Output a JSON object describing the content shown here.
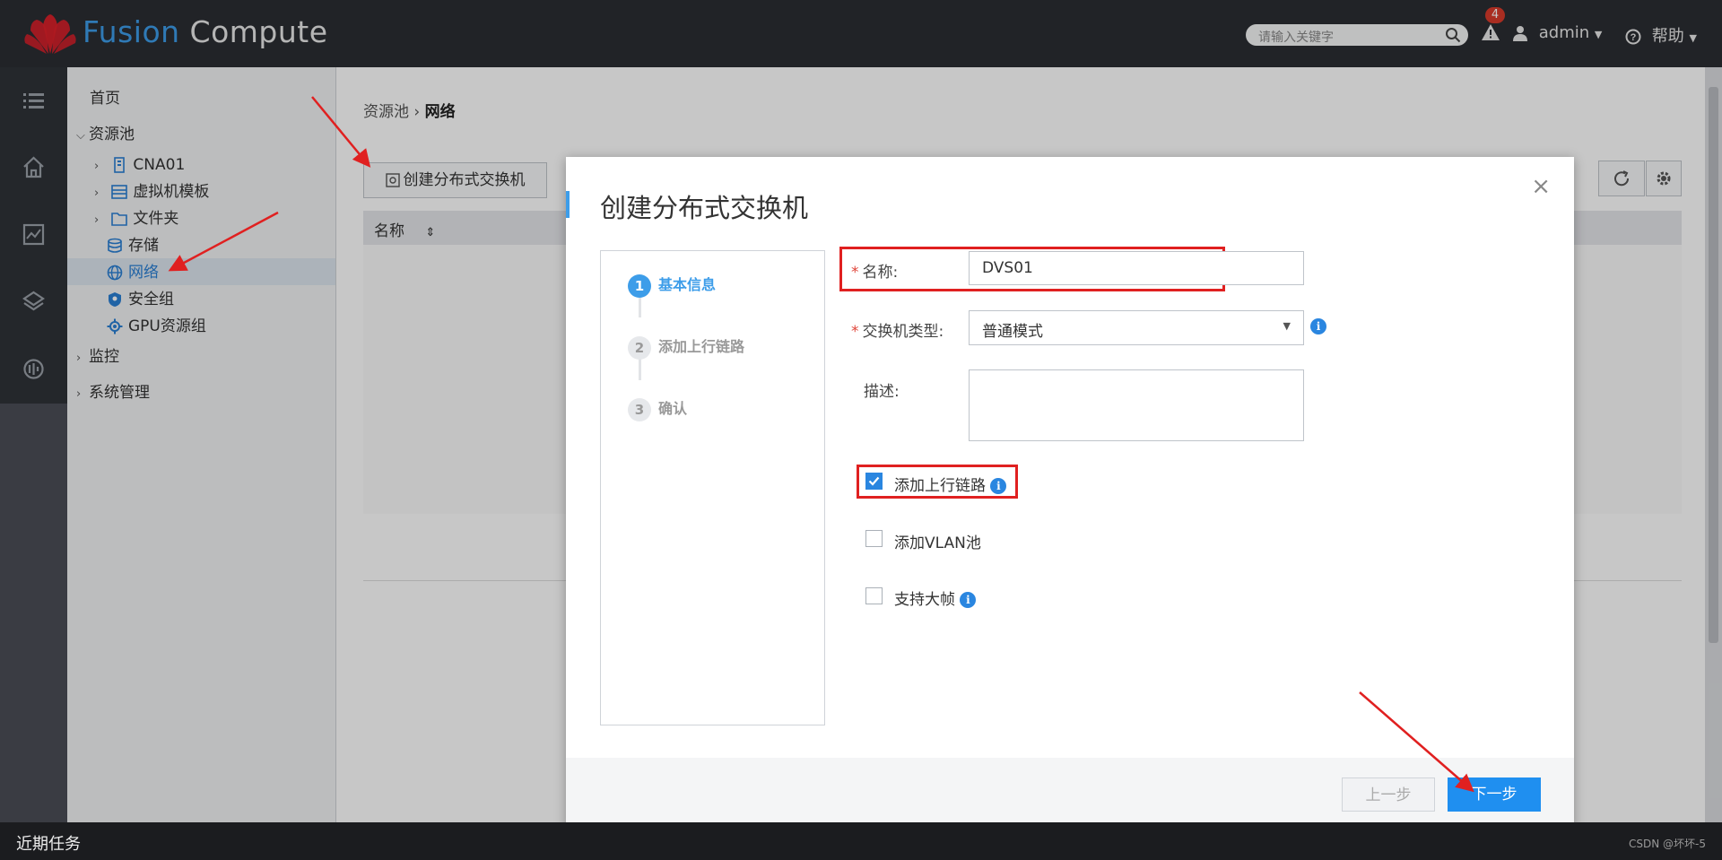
{
  "header": {
    "brand_part1": "Fusion",
    "brand_part2": " Compute",
    "search_placeholder": "请输入关键字",
    "alert_count": "4",
    "user": "admin",
    "help": "帮助",
    "accent_color": "#3d9de9"
  },
  "left_strip": {
    "icons": [
      "list-icon",
      "home-icon",
      "monitor-chart-icon",
      "layers-icon",
      "data-icon"
    ]
  },
  "tree": {
    "home": "首页",
    "resource_pool": "资源池",
    "items": [
      {
        "label": "CNA01",
        "icon": "server-icon"
      },
      {
        "label": "虚拟机模板",
        "icon": "template-icon"
      },
      {
        "label": "文件夹",
        "icon": "folder-icon"
      },
      {
        "label": "存储",
        "icon": "database-icon"
      },
      {
        "label": "网络",
        "icon": "globe-icon"
      },
      {
        "label": "安全组",
        "icon": "shield-icon"
      },
      {
        "label": "GPU资源组",
        "icon": "gpu-icon"
      }
    ],
    "monitor": "监控",
    "system": "系统管理"
  },
  "main": {
    "breadcrumb_parent": "资源池",
    "breadcrumb_current": "网络",
    "create_button": "创建分布式交换机",
    "column_name": "名称"
  },
  "dialog": {
    "title": "创建分布式交换机",
    "steps": [
      {
        "num": "1",
        "label": "基本信息",
        "active": true
      },
      {
        "num": "2",
        "label": "添加上行链路",
        "active": false
      },
      {
        "num": "3",
        "label": "确认",
        "active": false
      }
    ],
    "name_label": "名称:",
    "name_value": "DVS01",
    "type_label": "交换机类型:",
    "type_value": "普通模式",
    "desc_label": "描述:",
    "checkboxes": [
      {
        "label": "添加上行链路",
        "checked": true,
        "info": true
      },
      {
        "label": "添加VLAN池",
        "checked": false,
        "info": false
      },
      {
        "label": "支持大帧",
        "checked": false,
        "info": true
      }
    ],
    "prev_button": "上一步",
    "next_button": "下一步"
  },
  "bottom": {
    "recent_tasks": "近期任务",
    "watermark": "CSDN @坏坏-5"
  }
}
